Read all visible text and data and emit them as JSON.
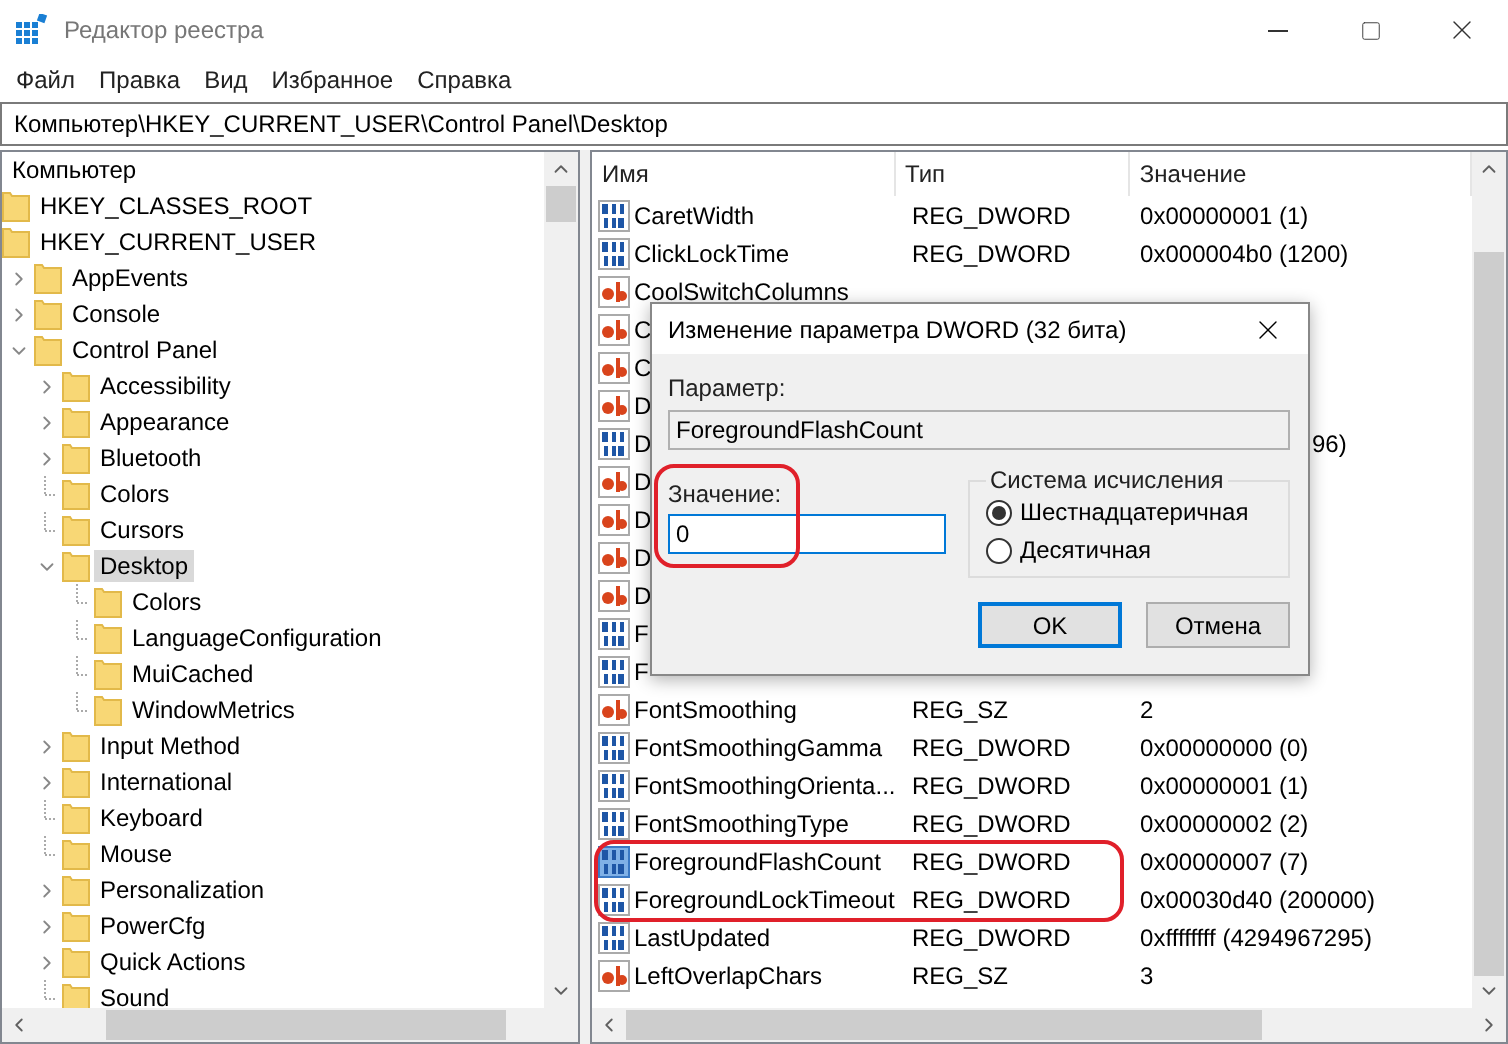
{
  "window": {
    "title": "Редактор реестра"
  },
  "menu": [
    "Файл",
    "Правка",
    "Вид",
    "Избранное",
    "Справка"
  ],
  "address": "Компьютер\\HKEY_CURRENT_USER\\Control Panel\\Desktop",
  "tree": [
    {
      "label": "Компьютер",
      "selected": false,
      "children": [
        {
          "label": "HKEY_CLASSES_ROOT",
          "selected": false
        },
        {
          "label": "HKEY_CURRENT_USER",
          "selected": false,
          "children": [
            {
              "label": "AppEvents",
              "selected": false,
              "expanded": false
            },
            {
              "label": "Console",
              "selected": false,
              "expanded": false
            },
            {
              "label": "Control Panel",
              "selected": false,
              "expanded": true,
              "children": [
                {
                  "label": "Accessibility",
                  "selected": false,
                  "expanded": false
                },
                {
                  "label": "Appearance",
                  "selected": false,
                  "expanded": false
                },
                {
                  "label": "Bluetooth",
                  "selected": false,
                  "expanded": false
                },
                {
                  "label": "Colors",
                  "selected": false
                },
                {
                  "label": "Cursors",
                  "selected": false
                },
                {
                  "label": "Desktop",
                  "selected": true,
                  "expanded": true,
                  "children": [
                    {
                      "label": "Colors",
                      "selected": false
                    },
                    {
                      "label": "LanguageConfiguration",
                      "selected": false
                    },
                    {
                      "label": "MuiCached",
                      "selected": false
                    },
                    {
                      "label": "WindowMetrics",
                      "selected": false
                    }
                  ]
                },
                {
                  "label": "Input Method",
                  "selected": false,
                  "expanded": false
                },
                {
                  "label": "International",
                  "selected": false,
                  "expanded": false
                },
                {
                  "label": "Keyboard",
                  "selected": false
                },
                {
                  "label": "Mouse",
                  "selected": false
                },
                {
                  "label": "Personalization",
                  "selected": false,
                  "expanded": false
                },
                {
                  "label": "PowerCfg",
                  "selected": false,
                  "expanded": false
                },
                {
                  "label": "Quick Actions",
                  "selected": false,
                  "expanded": false
                },
                {
                  "label": "Sound",
                  "selected": false
                }
              ]
            }
          ]
        }
      ]
    }
  ],
  "list": {
    "columns": [
      "Имя",
      "Тип",
      "Значение"
    ],
    "rows": [
      {
        "kind": "dword",
        "name": "CaretWidth",
        "type": "REG_DWORD",
        "value": "0x00000001 (1)",
        "selected": false
      },
      {
        "kind": "dword",
        "name": "ClickLockTime",
        "type": "REG_DWORD",
        "value": "0x000004b0 (1200)",
        "selected": false
      },
      {
        "kind": "string",
        "name": "CoolSwitchColumns",
        "selected": false
      },
      {
        "kind": "string",
        "name": "C",
        "selected": false
      },
      {
        "kind": "string",
        "name": "C",
        "selected": false
      },
      {
        "kind": "string",
        "name": "D",
        "selected": false
      },
      {
        "kind": "dword",
        "name": "D",
        "value_tail": "96)",
        "selected": false
      },
      {
        "kind": "string",
        "name": "D",
        "selected": false
      },
      {
        "kind": "string",
        "name": "D",
        "selected": false
      },
      {
        "kind": "string",
        "name": "D",
        "selected": false
      },
      {
        "kind": "string",
        "name": "D",
        "selected": false
      },
      {
        "kind": "dword",
        "name": "F",
        "selected": false
      },
      {
        "kind": "dword",
        "name": "F",
        "selected": false
      },
      {
        "kind": "string",
        "name": "FontSmoothing",
        "type": "REG_SZ",
        "value": "2",
        "selected": false
      },
      {
        "kind": "dword",
        "name": "FontSmoothingGamma",
        "type": "REG_DWORD",
        "value": "0x00000000 (0)",
        "selected": false
      },
      {
        "kind": "dword",
        "name": "FontSmoothingOrienta...",
        "type": "REG_DWORD",
        "value": "0x00000001 (1)",
        "selected": false
      },
      {
        "kind": "dword",
        "name": "FontSmoothingType",
        "type": "REG_DWORD",
        "value": "0x00000002 (2)",
        "selected": false
      },
      {
        "kind": "dword",
        "name": "ForegroundFlashCount",
        "type": "REG_DWORD",
        "value": "0x00000007 (7)",
        "selected": true
      },
      {
        "kind": "dword",
        "name": "ForegroundLockTimeout",
        "type": "REG_DWORD",
        "value": "0x00030d40 (200000)",
        "selected": false
      },
      {
        "kind": "dword",
        "name": "LastUpdated",
        "type": "REG_DWORD",
        "value": "0xffffffff (4294967295)",
        "selected": false
      },
      {
        "kind": "string",
        "name": "LeftOverlapChars",
        "type": "REG_SZ",
        "value": "3",
        "selected": false
      }
    ]
  },
  "dialog": {
    "title": "Изменение параметра DWORD (32 бита)",
    "param_label": "Параметр:",
    "param_value": "ForegroundFlashCount",
    "value_label": "Значение:",
    "value": "0",
    "base_group": "Система исчисления",
    "bases": [
      {
        "label": "Шестнадцатеричная",
        "selected": true
      },
      {
        "label": "Десятичная",
        "selected": false
      }
    ],
    "buttons": [
      {
        "label": "OK",
        "default": true
      },
      {
        "label": "Отмена",
        "default": false
      }
    ]
  }
}
